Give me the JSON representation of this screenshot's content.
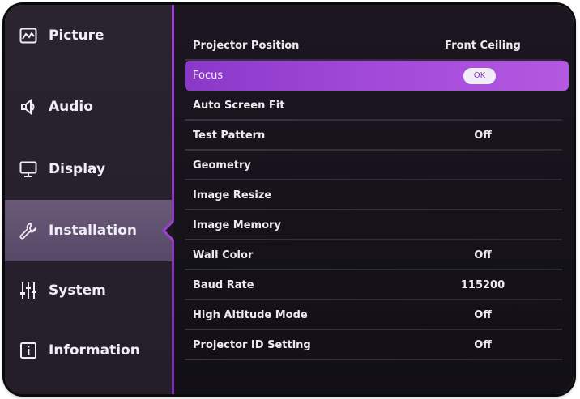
{
  "sidebar": {
    "items": [
      {
        "label": "Picture",
        "icon": "picture-icon"
      },
      {
        "label": "Audio",
        "icon": "speaker-icon"
      },
      {
        "label": "Display",
        "icon": "monitor-icon"
      },
      {
        "label": "Installation",
        "icon": "wrench-icon",
        "active": true
      },
      {
        "label": "System",
        "icon": "sliders-icon"
      },
      {
        "label": "Information",
        "icon": "info-icon"
      }
    ]
  },
  "menu": {
    "rows": [
      {
        "label": "Projector Position",
        "value": "Front Ceiling"
      },
      {
        "label": "Focus",
        "value": "OK",
        "selected": true
      },
      {
        "label": "Auto Screen Fit",
        "value": ""
      },
      {
        "label": "Test Pattern",
        "value": "Off"
      },
      {
        "label": "Geometry",
        "value": ""
      },
      {
        "label": "Image Resize",
        "value": ""
      },
      {
        "label": "Image Memory",
        "value": ""
      },
      {
        "label": "Wall Color",
        "value": "Off"
      },
      {
        "label": "Baud Rate",
        "value": "115200"
      },
      {
        "label": "High Altitude Mode",
        "value": "Off"
      },
      {
        "label": "Projector ID Setting",
        "value": "Off"
      }
    ]
  },
  "colors": {
    "accent": "#a040d8",
    "active_sidebar": "#5e4e6e",
    "background": "#17131c"
  }
}
